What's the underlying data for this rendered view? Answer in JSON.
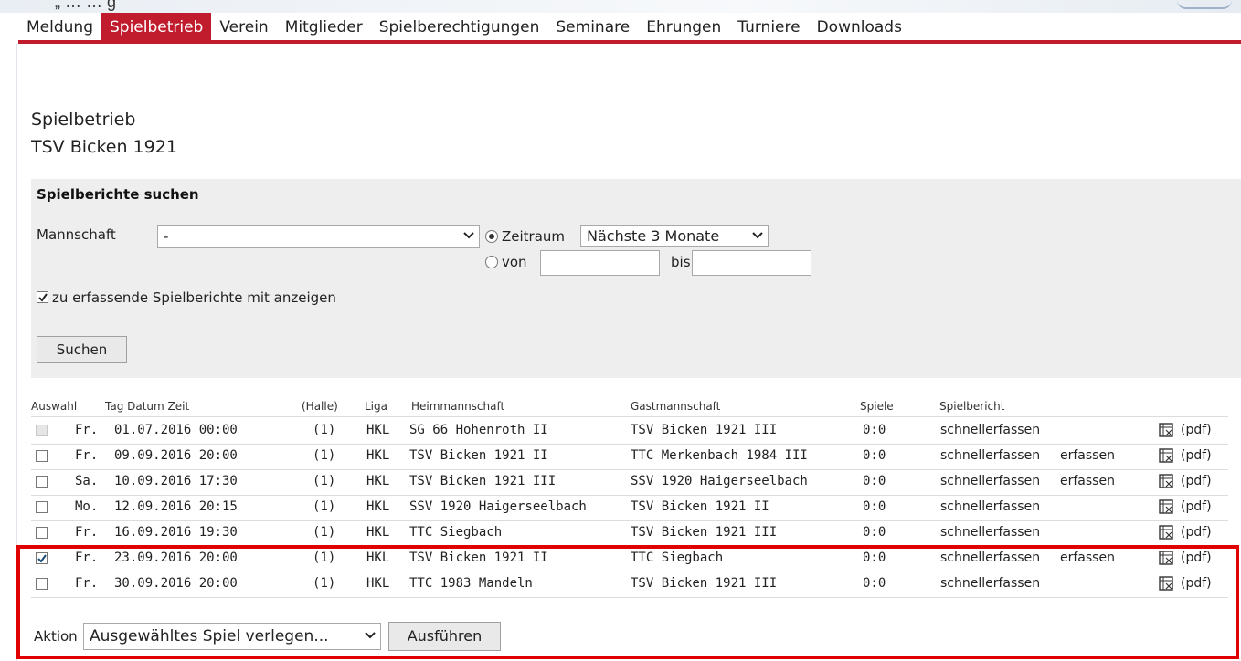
{
  "banner": {
    "text": "„ … … g"
  },
  "nav": {
    "items": [
      "Meldung",
      "Spielbetrieb",
      "Verein",
      "Mitglieder",
      "Spielberechtigungen",
      "Seminare",
      "Ehrungen",
      "Turniere",
      "Downloads"
    ],
    "active": "Spielbetrieb"
  },
  "page": {
    "title": "Spielbetrieb",
    "club": "TSV Bicken 1921"
  },
  "search": {
    "heading": "Spielberichte suchen",
    "team_label": "Mannschaft",
    "team_value": "-",
    "period_label": "Zeitraum",
    "period_value": "Nächste 3 Monate",
    "from_label": "von",
    "to_label": "bis",
    "from_value": "",
    "to_value": "",
    "include_label": "zu erfassende Spielberichte mit anzeigen",
    "include_checked": true,
    "button": "Suchen"
  },
  "table": {
    "headers": {
      "select": "Auswahl",
      "datetime": "Tag Datum Zeit",
      "hall": "(Halle)",
      "league": "Liga",
      "home": "Heimmannschaft",
      "guest": "Gastmannschaft",
      "games": "Spiele",
      "report": "Spielbericht"
    },
    "rows": [
      {
        "day": "Fr.",
        "datetime": "01.07.2016 00:00",
        "hall": "(1)",
        "league": "HKL",
        "home": "SG 66 Hohenroth II",
        "guest": "TSV Bicken 1921 III",
        "games": "0:0",
        "report1": "schnellerfassen",
        "report2": "",
        "pdf": "(pdf)",
        "checked": false,
        "disabled": true
      },
      {
        "day": "Fr.",
        "datetime": "09.09.2016 20:00",
        "hall": "(1)",
        "league": "HKL",
        "home": "TSV Bicken 1921 II",
        "guest": "TTC Merkenbach 1984 III",
        "games": "0:0",
        "report1": "schnellerfassen",
        "report2": "erfassen",
        "pdf": "(pdf)",
        "checked": false,
        "disabled": false
      },
      {
        "day": "Sa.",
        "datetime": "10.09.2016 17:30",
        "hall": "(1)",
        "league": "HKL",
        "home": "TSV Bicken 1921 III",
        "guest": "SSV 1920 Haigerseelbach",
        "games": "0:0",
        "report1": "schnellerfassen",
        "report2": "erfassen",
        "pdf": "(pdf)",
        "checked": false,
        "disabled": false
      },
      {
        "day": "Mo.",
        "datetime": "12.09.2016 20:15",
        "hall": "(1)",
        "league": "HKL",
        "home": "SSV 1920 Haigerseelbach",
        "guest": "TSV Bicken 1921 II",
        "games": "0:0",
        "report1": "schnellerfassen",
        "report2": "",
        "pdf": "(pdf)",
        "checked": false,
        "disabled": false
      },
      {
        "day": "Fr.",
        "datetime": "16.09.2016 19:30",
        "hall": "(1)",
        "league": "HKL",
        "home": "TTC Siegbach",
        "guest": "TSV Bicken 1921 III",
        "games": "0:0",
        "report1": "schnellerfassen",
        "report2": "",
        "pdf": "(pdf)",
        "checked": false,
        "disabled": false
      },
      {
        "day": "Fr.",
        "datetime": "23.09.2016 20:00",
        "hall": "(1)",
        "league": "HKL",
        "home": "TSV Bicken 1921 II",
        "guest": "TTC Siegbach",
        "games": "0:0",
        "report1": "schnellerfassen",
        "report2": "erfassen",
        "pdf": "(pdf)",
        "checked": true,
        "disabled": false
      },
      {
        "day": "Fr.",
        "datetime": "30.09.2016 20:00",
        "hall": "(1)",
        "league": "HKL",
        "home": "TTC 1983 Mandeln",
        "guest": "TSV Bicken 1921 III",
        "games": "0:0",
        "report1": "schnellerfassen",
        "report2": "",
        "pdf": "(pdf)",
        "checked": false,
        "disabled": false
      }
    ]
  },
  "action": {
    "label": "Aktion",
    "value": "Ausgewähltes Spiel verlegen...",
    "button": "Ausführen"
  },
  "colors": {
    "accent": "#c01c2e",
    "highlight": "#e00000",
    "panel": "#eeeeee"
  },
  "icons": {
    "pdf": "pdf-document-icon",
    "dropdown": "chevron-down-icon"
  }
}
